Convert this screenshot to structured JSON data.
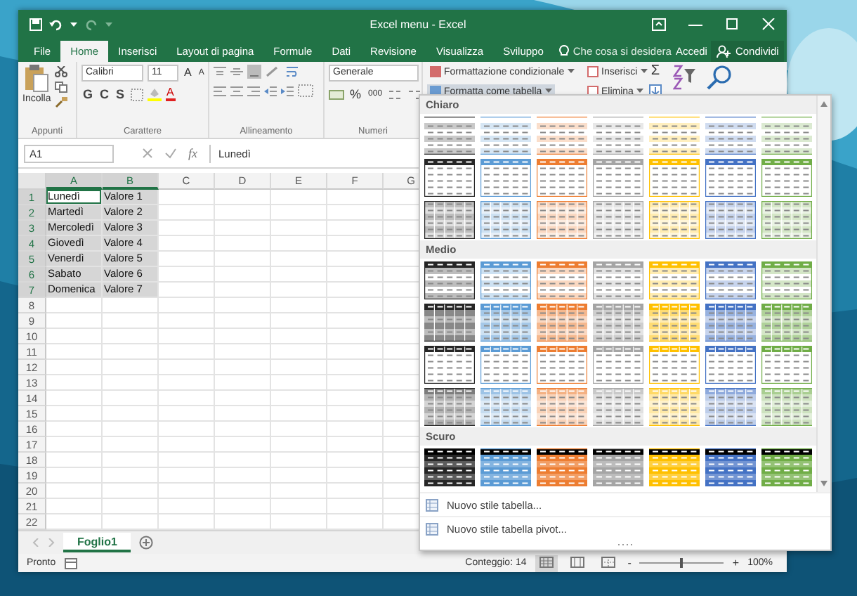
{
  "window": {
    "title": "Excel menu - Excel"
  },
  "tabs": [
    {
      "label": "File",
      "selected": false
    },
    {
      "label": "Home",
      "selected": true
    },
    {
      "label": "Inserisci",
      "selected": false
    },
    {
      "label": "Layout di pagina",
      "selected": false
    },
    {
      "label": "Formule",
      "selected": false
    },
    {
      "label": "Dati",
      "selected": false
    },
    {
      "label": "Revisione",
      "selected": false
    },
    {
      "label": "Visualizza",
      "selected": false
    },
    {
      "label": "Sviluppo",
      "selected": false
    }
  ],
  "tell_me": {
    "placeholder": "Che cosa si desidera"
  },
  "account": {
    "sign_in": "Accedi",
    "share": "Condividi"
  },
  "ribbon": {
    "clipboard": {
      "paste": "Incolla",
      "label": "Appunti"
    },
    "font": {
      "name": "Calibri",
      "size": "11",
      "grow": "A",
      "shrink": "A",
      "bold": "G",
      "italic": "C",
      "underline": "S",
      "color_letter": "A",
      "label": "Carattere"
    },
    "alignment": {
      "label": "Allineamento"
    },
    "number": {
      "format": "Generale",
      "percent": "%",
      "thousands": "000",
      "label": "Numeri"
    },
    "styles": [
      {
        "label": "Formattazione condizionale",
        "selected": false
      },
      {
        "label": "Formatta come tabella",
        "selected": true
      }
    ],
    "cells": [
      {
        "label": "Inserisci"
      },
      {
        "label": "Elimina"
      }
    ],
    "editing": {
      "sum": "Σ"
    }
  },
  "formula_bar": {
    "name_box": "A1",
    "fx": "fx",
    "value": "Lunedì"
  },
  "sheet": {
    "columns": [
      {
        "label": "A",
        "selected": true
      },
      {
        "label": "B",
        "selected": true
      },
      {
        "label": "C",
        "selected": false
      },
      {
        "label": "D",
        "selected": false
      },
      {
        "label": "E",
        "selected": false
      },
      {
        "label": "F",
        "selected": false
      },
      {
        "label": "G",
        "selected": false
      }
    ],
    "rows": [
      {
        "number": "1",
        "selected": true,
        "cells": [
          {
            "text": "Lunedì",
            "active": true
          },
          {
            "text": "Valore 1",
            "active": false
          }
        ]
      },
      {
        "number": "2",
        "selected": true,
        "cells": [
          {
            "text": "Martedì",
            "active": false
          },
          {
            "text": "Valore 2",
            "active": false
          }
        ]
      },
      {
        "number": "3",
        "selected": true,
        "cells": [
          {
            "text": "Mercoledì",
            "active": false
          },
          {
            "text": "Valore 3",
            "active": false
          }
        ]
      },
      {
        "number": "4",
        "selected": true,
        "cells": [
          {
            "text": "Giovedì",
            "active": false
          },
          {
            "text": "Valore 4",
            "active": false
          }
        ]
      },
      {
        "number": "5",
        "selected": true,
        "cells": [
          {
            "text": "Venerdì",
            "active": false
          },
          {
            "text": "Valore 5",
            "active": false
          }
        ]
      },
      {
        "number": "6",
        "selected": true,
        "cells": [
          {
            "text": "Sabato",
            "active": false
          },
          {
            "text": "Valore 6",
            "active": false
          }
        ]
      },
      {
        "number": "7",
        "selected": true,
        "cells": [
          {
            "text": "Domenica",
            "active": false
          },
          {
            "text": "Valore 7",
            "active": false
          }
        ]
      },
      {
        "number": "8",
        "selected": false
      },
      {
        "number": "9",
        "selected": false
      },
      {
        "number": "10",
        "selected": false
      },
      {
        "number": "11",
        "selected": false
      },
      {
        "number": "12",
        "selected": false
      },
      {
        "number": "13",
        "selected": false
      },
      {
        "number": "14",
        "selected": false
      },
      {
        "number": "15",
        "selected": false
      },
      {
        "number": "16",
        "selected": false
      },
      {
        "number": "17",
        "selected": false
      },
      {
        "number": "18",
        "selected": false
      },
      {
        "number": "19",
        "selected": false
      },
      {
        "number": "20",
        "selected": false
      },
      {
        "number": "21",
        "selected": false
      },
      {
        "number": "22",
        "selected": false
      }
    ]
  },
  "sheet_tabs": [
    {
      "label": "Foglio1",
      "selected": true
    }
  ],
  "status_bar": {
    "state": "Pronto",
    "count": "Conteggio: 14",
    "zoom_out": "-",
    "zoom_in": "+",
    "zoom": "100%",
    "zoom_slider": {
      "level": 0.5
    },
    "views": [
      {
        "kind": "normal",
        "selected": true
      },
      {
        "kind": "layout",
        "selected": false
      },
      {
        "kind": "break",
        "selected": false
      }
    ]
  },
  "gallery": {
    "colors": [
      {
        "color": "#262626"
      },
      {
        "color": "#5b9bd5"
      },
      {
        "color": "#ed7d31"
      },
      {
        "color": "#a5a5a5"
      },
      {
        "color": "#ffc000"
      },
      {
        "color": "#4472c4"
      },
      {
        "color": "#70ad47"
      }
    ],
    "sections": [
      {
        "title": "Chiaro",
        "rows": [
          {
            "kind": "light"
          },
          {
            "kind": "header"
          },
          {
            "kind": "grid"
          }
        ]
      },
      {
        "title": "Medio",
        "rows": [
          {
            "kind": "header-banded"
          },
          {
            "kind": "header-striped"
          },
          {
            "kind": "grid-banded"
          },
          {
            "kind": "solid-banded"
          }
        ]
      },
      {
        "title": "Scuro",
        "rows": [
          {
            "kind": "dark"
          }
        ]
      }
    ],
    "actions": [
      {
        "label": "Nuovo stile tabella..."
      },
      {
        "label": "Nuovo stile tabella pivot..."
      }
    ]
  }
}
